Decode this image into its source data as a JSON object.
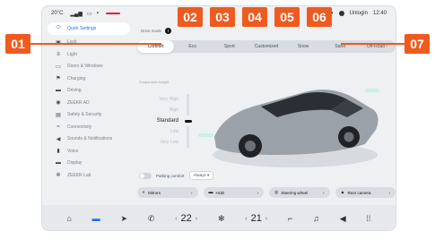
{
  "status_bar": {
    "temperature": "20°C",
    "alert_text": "",
    "user_label": "Unlogin",
    "time": "12:40"
  },
  "sidebar": {
    "items": [
      {
        "label": "Quick Settings",
        "icon": "quick-settings-icon",
        "active": true
      },
      {
        "label": "Lock",
        "icon": "lock-icon"
      },
      {
        "label": "Light",
        "icon": "light-icon"
      },
      {
        "label": "Doors & Windows",
        "icon": "door-icon"
      },
      {
        "label": "Charging",
        "icon": "charging-icon"
      },
      {
        "label": "Driving",
        "icon": "driving-icon"
      },
      {
        "label": "ZEEKR AD",
        "icon": "assist-icon"
      },
      {
        "label": "Safety & Security",
        "icon": "shield-icon"
      },
      {
        "label": "Connectivity",
        "icon": "wifi-icon"
      },
      {
        "label": "Sounds & Notifications",
        "icon": "sound-icon"
      },
      {
        "label": "Voice",
        "icon": "mic-icon"
      },
      {
        "label": "Display",
        "icon": "display-icon"
      },
      {
        "label": "ZEEKR Lab",
        "icon": "lab-icon"
      }
    ]
  },
  "main": {
    "drive_mode_label": "Drive mode",
    "modes": [
      {
        "label": "Comfort",
        "selected": true
      },
      {
        "label": "Eco"
      },
      {
        "label": "Sport"
      },
      {
        "label": "Customized"
      },
      {
        "label": "Snow"
      },
      {
        "label": "Sand"
      },
      {
        "label": "Off-Road"
      }
    ],
    "suspension_label": "Suspension height",
    "levels": [
      "Very High",
      "High",
      "Standard",
      "Low",
      "Very Low"
    ],
    "current_level": "Standard",
    "parking_label": "Parking comfort",
    "always_label": "Always",
    "quick_buttons": [
      {
        "label": "Mirrors",
        "icon": "mirror-icon"
      },
      {
        "label": "HUD",
        "icon": "hud-icon"
      },
      {
        "label": "Steering wheel",
        "icon": "steering-wheel-icon"
      },
      {
        "label": "Rear camera",
        "icon": "camera-icon"
      }
    ],
    "car_color": "#9aa1a8",
    "accent_color": "#1a73e8"
  },
  "dock": {
    "left_temp": "22",
    "right_temp": "21",
    "items": [
      "home-icon",
      "car-icon",
      "navigation-icon",
      "phone-icon",
      "fan-icon",
      "seat-icon",
      "music-icon",
      "volume-icon",
      "apps-icon"
    ]
  },
  "callouts": [
    "01",
    "02",
    "03",
    "04",
    "05",
    "06",
    "07"
  ]
}
